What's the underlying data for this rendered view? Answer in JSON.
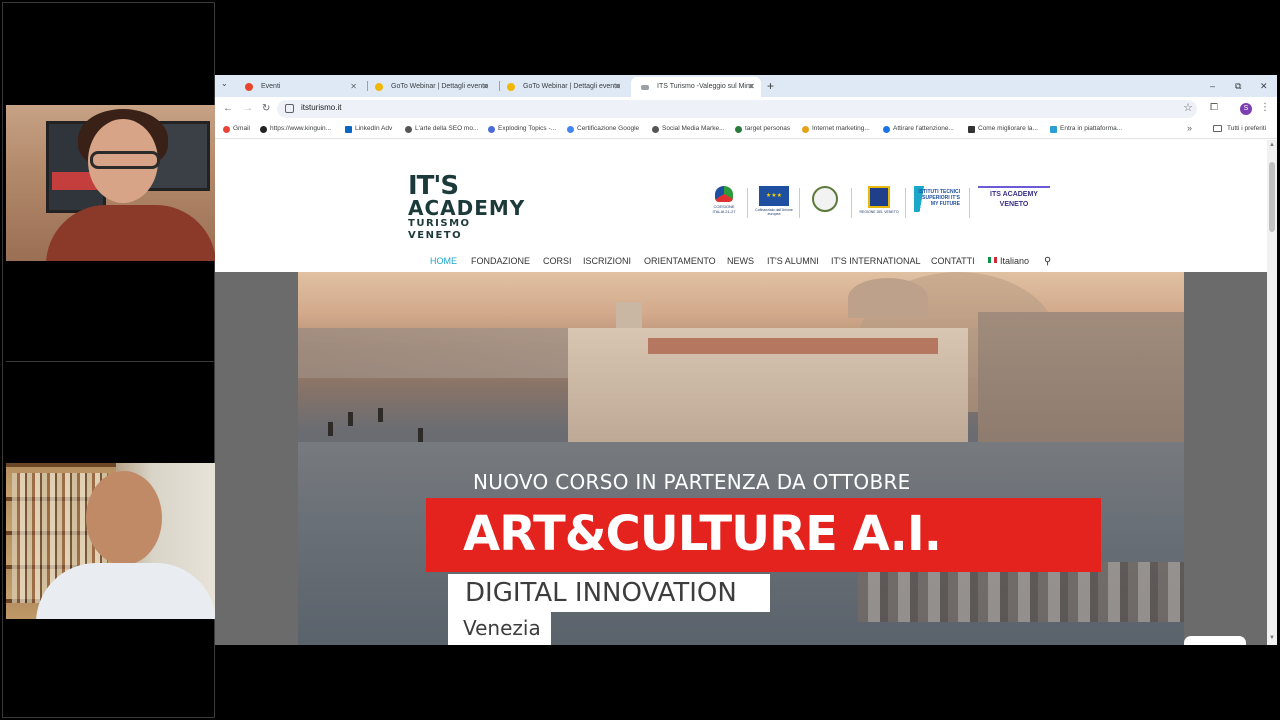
{
  "browser": {
    "tabs": [
      {
        "label": "Eventi",
        "favicon_color": "#e8452c"
      },
      {
        "label": "GoTo Webinar | Dettagli evento",
        "favicon_color": "#f2b705"
      },
      {
        "label": "GoTo Webinar | Dettagli evento",
        "favicon_color": "#f2b705"
      },
      {
        "label": "ITS Turismo -Valeggio sul Minc",
        "favicon_color": "#1d3a3a"
      }
    ],
    "url": "itsturismo.it",
    "profile_initial": "S",
    "bookmarks": [
      {
        "label": "Gmail",
        "color": "#ea4335"
      },
      {
        "label": "https://www.kinguin...",
        "color": "#222222"
      },
      {
        "label": "LinkedIn Adv",
        "color": "#0a66c2"
      },
      {
        "label": "L'arte della SEO mo...",
        "color": "#555555"
      },
      {
        "label": "Exploding Topics -...",
        "color": "#4b6bd6"
      },
      {
        "label": "Certificazione Google",
        "color": "#4285f4"
      },
      {
        "label": "Social Media Marke...",
        "color": "#555555"
      },
      {
        "label": "target personas",
        "color": "#2b7a3d"
      },
      {
        "label": "Internet marketing...",
        "color": "#e3a21a"
      },
      {
        "label": "Attirare l'attenzione...",
        "color": "#1a73e8"
      },
      {
        "label": "Come migliorare la...",
        "color": "#333333"
      },
      {
        "label": "Entra in piattaforma...",
        "color": "#2a9fd6"
      }
    ],
    "all_bookmarks_label": "Tutti i preferiti"
  },
  "site": {
    "logo": {
      "line1": "IT'S",
      "line2": "ACADEMY",
      "line3": "TURISMO VENETO"
    },
    "partners": [
      {
        "label": "COESIONE ITALIA 21-27"
      },
      {
        "label": "Cofinanziato dall'Unione europea"
      },
      {
        "label": "Repubblica Italiana"
      },
      {
        "label": "REGIONE DEL VENETO"
      },
      {
        "label": "ISTITUTI TECNICI SUPERIORI IT'S MY FUTURE"
      },
      {
        "label": "ITS ACADEMY VENETO"
      }
    ],
    "nav": [
      {
        "label": "HOME"
      },
      {
        "label": "FONDAZIONE"
      },
      {
        "label": "CORSI"
      },
      {
        "label": "ISCRIZIONI"
      },
      {
        "label": "ORIENTAMENTO"
      },
      {
        "label": "NEWS"
      },
      {
        "label": "IT'S ALUMNI"
      },
      {
        "label": "IT'S INTERNATIONAL"
      },
      {
        "label": "CONTATTI"
      },
      {
        "label": "Italiano"
      }
    ],
    "side_button_label": "+",
    "hero": {
      "kicker": "NUOVO CORSO IN PARTENZA DA OTTOBRE",
      "title": "ART&CULTURE A.I.",
      "subtitle": "DIGITAL INNOVATION",
      "city": "Venezia"
    }
  },
  "colors": {
    "accent": "#1ba8c8",
    "banner_red": "#e4231e",
    "logo_dark": "#1d3a3a"
  }
}
